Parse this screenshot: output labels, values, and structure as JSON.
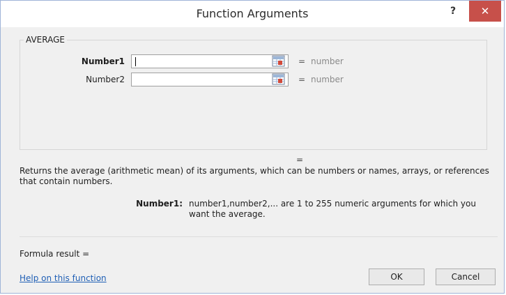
{
  "window": {
    "title": "Function Arguments",
    "help_label": "?",
    "close_label": "✕"
  },
  "function": {
    "name": "AVERAGE",
    "args": [
      {
        "label": "Number1",
        "value": "",
        "result": "number",
        "bold": true
      },
      {
        "label": "Number2",
        "value": "",
        "result": "number",
        "bold": false
      }
    ],
    "result_equals": "=",
    "description": "Returns the average (arithmetic mean) of its arguments, which can be numbers or names, arrays, or references that contain numbers.",
    "arg_help_name": "Number1:",
    "arg_help_text": "number1,number2,... are 1 to 255 numeric arguments for which you want the average."
  },
  "footer": {
    "formula_result_label": "Formula result =",
    "help_link": "Help on this function",
    "ok_label": "OK",
    "cancel_label": "Cancel"
  },
  "icons": {
    "collapse": "range-selector-icon"
  },
  "colors": {
    "close_button": "#c7504a",
    "link": "#1f5fb5",
    "placeholder_result": "#8a8a8a"
  }
}
